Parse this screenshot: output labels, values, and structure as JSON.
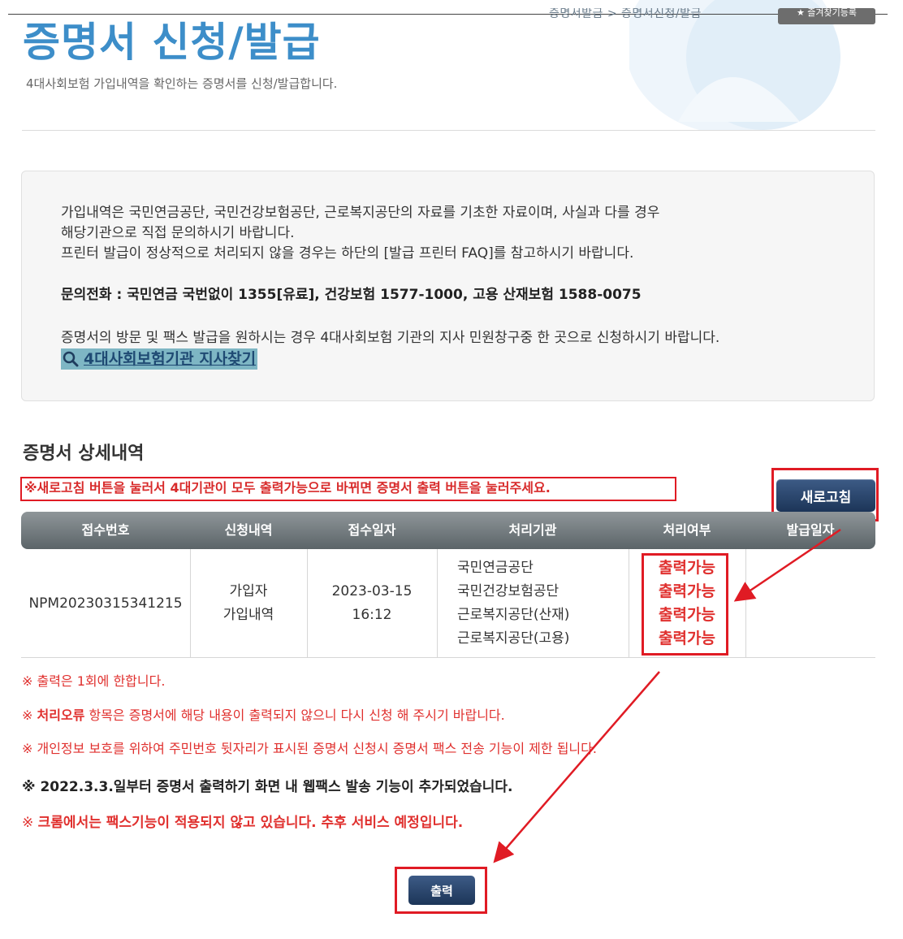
{
  "header": {
    "title": "증명서 신청/발급",
    "subtitle": "4대사회보험 가입내역을 확인하는 증명서를 신청/발급합니다.",
    "breadcrumb": "증명서발급 > 증명서신청/발급",
    "bookmark_label": "★ 즐겨찾기등록"
  },
  "notice": {
    "line1": "가입내역은 국민연금공단, 국민건강보험공단, 근로복지공단의 자료를 기초한 자료이며, 사실과 다를 경우",
    "line2": "해당기관으로 직접 문의하시기 바랍니다.",
    "line3": "프린터 발급이 정상적으로 처리되지 않을 경우는 하단의 [발급 프린터 FAQ]를 참고하시기 바랍니다.",
    "contact": "문의전화 : 국민연금 국번없이 1355[유료], 건강보험 1577-1000, 고용 산재보험 1588-0075",
    "line5": "증명서의 방문 및 팩스 발급을 원하시는 경우 4대사회보험 기관의 지사 민원창구중 한 곳으로 신청하시기 바랍니다.",
    "branch_link": "4대사회보험기관 지사찾기"
  },
  "detail": {
    "section_title": "증명서 상세내역",
    "warning": "※새로고침 버튼을 눌러서 4대기관이 모두 출력가능으로 바뀌면 증명서 출력 버튼을 눌러주세요.",
    "refresh_label": "새로고침",
    "columns": [
      "접수번호",
      "신청내역",
      "접수일자",
      "처리기관",
      "처리여부",
      "발급일자"
    ],
    "row": {
      "receipt_no": "NPM20230315341215",
      "request": [
        "가입자",
        "가입내역"
      ],
      "date": [
        "2023-03-15",
        "16:12"
      ],
      "agencies": [
        "국민연금공단",
        "국민건강보험공단",
        "근로복지공단(산재)",
        "근로복지공단(고용)"
      ],
      "statuses": [
        "출력가능",
        "출력가능",
        "출력가능",
        "출력가능"
      ],
      "issue_date": ""
    }
  },
  "notes": {
    "n1": "※ 출력은 1회에 한합니다.",
    "n2_prefix": "※ ",
    "n2_bold": "처리오류",
    "n2_rest": " 항목은 증명서에 해당 내용이 출력되지 않으니 다시 신청 해 주시기 바랍니다.",
    "n3": "※ 개인정보 보호를 위하여 주민번호 뒷자리가 표시된 증명서 신청시 증명서 팩스 전송 기능이 제한 됩니다.",
    "n4": "※ 2022.3.3.일부터 증명서 출력하기 화면 내 웹팩스 발송 기능이 추가되었습니다.",
    "n5_prefix": "※ ",
    "n5_bold": "크롬에서는 팩스기능이 적용되지 않고 있습니다. 추후 서비스 예정입니다."
  },
  "print_label": "출력",
  "colors": {
    "title_blue": "#3d8ec9",
    "alert_red": "#e01b24",
    "button_navy": "#1c3558",
    "link_bg": "#7eb6c4"
  }
}
